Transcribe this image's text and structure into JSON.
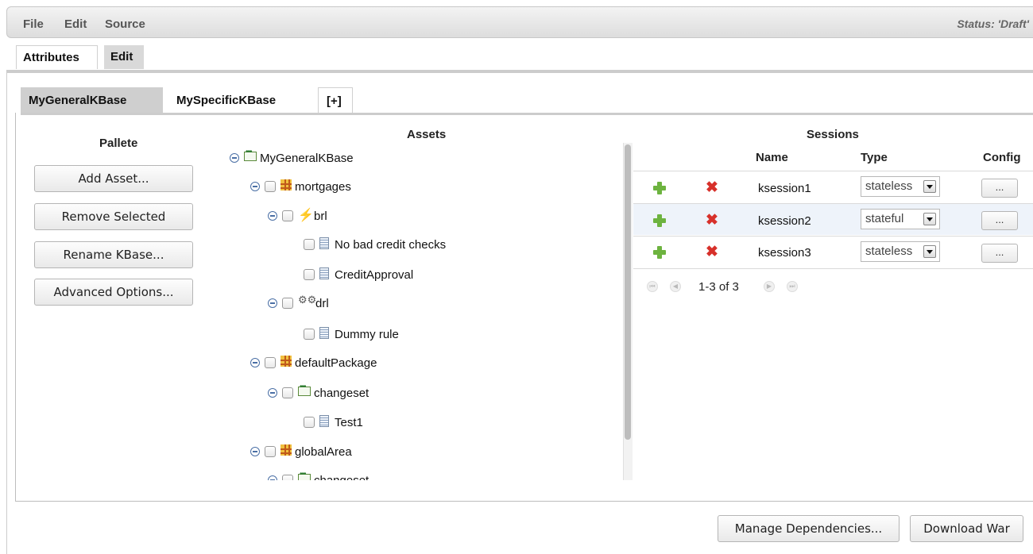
{
  "menu": {
    "items": [
      "File",
      "Edit",
      "Source"
    ],
    "status": "Status: 'Draft'"
  },
  "top_tabs": [
    "Attributes",
    "Edit"
  ],
  "kbase_tabs": [
    "MyGeneralKBase",
    "MySpecificKBase",
    "[+]"
  ],
  "pallete": {
    "title": "Pallete",
    "buttons": [
      "Add Asset...",
      "Remove Selected",
      "Rename KBase...",
      "Advanced Options..."
    ]
  },
  "assets": {
    "title": "Assets",
    "tree": [
      {
        "label": "MyGeneralKBase",
        "icon": "kbase-icon"
      },
      {
        "label": "mortgages",
        "icon": "package-icon"
      },
      {
        "label": "brl",
        "icon": "brl-icon"
      },
      {
        "label": "No bad credit checks",
        "icon": "document-icon"
      },
      {
        "label": "CreditApproval",
        "icon": "document-icon"
      },
      {
        "label": "drl",
        "icon": "gear-icon"
      },
      {
        "label": "Dummy rule",
        "icon": "document-icon"
      },
      {
        "label": "defaultPackage",
        "icon": "package-icon"
      },
      {
        "label": "changeset",
        "icon": "changeset-icon"
      },
      {
        "label": "Test1",
        "icon": "document-icon"
      },
      {
        "label": "globalArea",
        "icon": "package-icon"
      },
      {
        "label": "changeset",
        "icon": "changeset-icon"
      }
    ]
  },
  "sessions": {
    "title": "Sessions",
    "columns": [
      "Name",
      "Type",
      "Config"
    ],
    "rows": [
      {
        "name": "ksession1",
        "type": "stateless",
        "config": "..."
      },
      {
        "name": "ksession2",
        "type": "stateful",
        "config": "..."
      },
      {
        "name": "ksession3",
        "type": "stateless",
        "config": "..."
      }
    ],
    "pager": "1-3 of 3"
  },
  "footer": {
    "buttons": [
      "Manage Dependencies...",
      "Download War"
    ]
  },
  "colors": {
    "accent_add": "#6db33f",
    "accent_delete": "#d7302a",
    "selected_tab": "#cfcfcf"
  }
}
